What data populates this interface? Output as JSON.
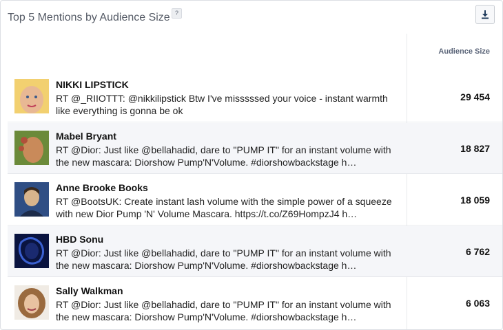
{
  "widget": {
    "title": "Top 5 Mentions by Audience Size",
    "help_label": "?",
    "download_icon": "download-icon"
  },
  "table": {
    "column_header": "Audience Size",
    "rows": [
      {
        "name": "NIKKI LIPSTICK",
        "text": "RT @_RIIOTTT: @nikkilipstick Btw I've misssssed your voice - instant warmth like everything is gonna be ok",
        "audience": "29 454",
        "avatar_colors": [
          "#e8b894",
          "#f2d070"
        ]
      },
      {
        "name": "Mabel Bryant",
        "text": "RT @Dior: Just like @bellahadid, dare to \"PUMP IT\" for an instant volume with the new mascara: Diorshow Pump'N'Volume. #diorshowbackstage h…",
        "audience": "18 827",
        "avatar_colors": [
          "#6b8a3a",
          "#b0503a"
        ]
      },
      {
        "name": "Anne Brooke Books",
        "text": "RT @BootsUK: Create instant lash volume with the simple power of a squeeze with new Dior Pump 'N' Volume Mascara. https://t.co/Z69HompzJ4 h…",
        "audience": "18 059",
        "avatar_colors": [
          "#2f4e84",
          "#d8b48c"
        ]
      },
      {
        "name": "HBD Sonu",
        "text": "RT @Dior: Just like @bellahadid, dare to \"PUMP IT\" for an instant volume with the new mascara: Diorshow Pump'N'Volume. #diorshowbackstage h…",
        "audience": "6 762",
        "avatar_colors": [
          "#0a1440",
          "#3a60d0"
        ]
      },
      {
        "name": "Sally Walkman",
        "text": "RT @Dior: Just like @bellahadid, dare to \"PUMP IT\" for an instant volume with the new mascara: Diorshow Pump'N'Volume. #diorshowbackstage h…",
        "audience": "6 063",
        "avatar_colors": [
          "#9a6a3e",
          "#e8c2a0"
        ]
      }
    ]
  }
}
